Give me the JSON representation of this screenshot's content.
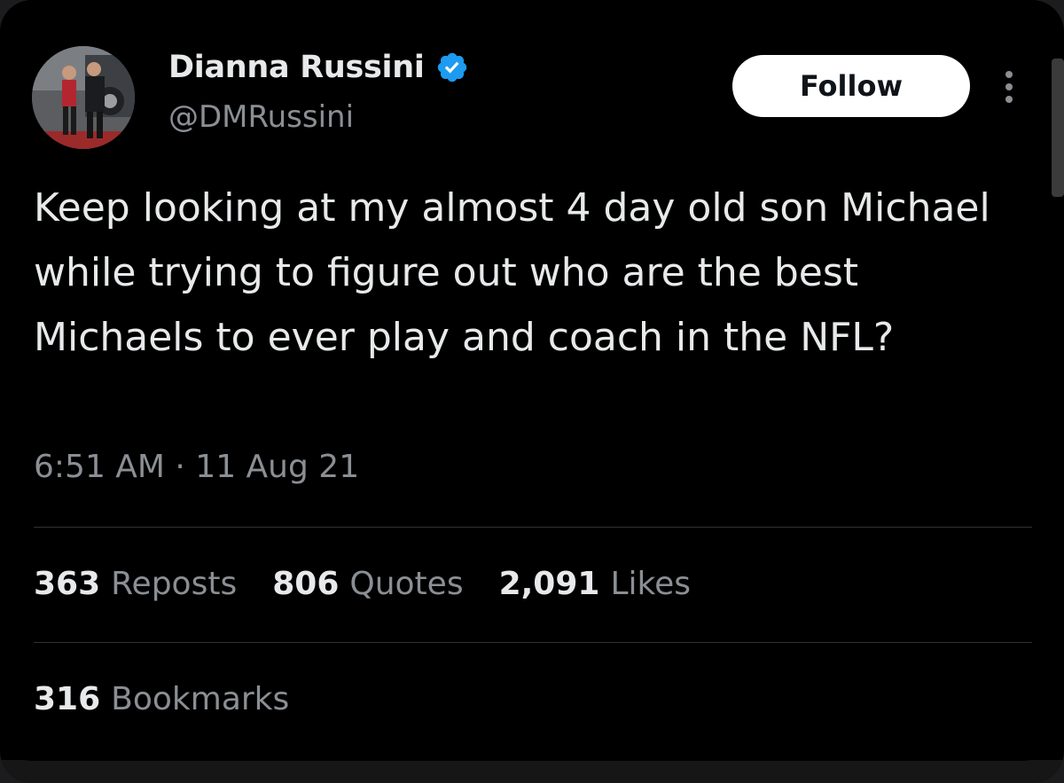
{
  "author": {
    "display_name": "Dianna Russini",
    "handle": "@DMRussini",
    "verified": true,
    "avatar_alt": "avatar"
  },
  "actions": {
    "follow_label": "Follow",
    "more_icon": "more-vertical-icon"
  },
  "tweet": {
    "text": "Keep looking at my almost 4 day old son Michael while trying to figure out who are the best Michaels to ever play and coach in the NFL?",
    "timestamp": "6:51 AM · 11 Aug 21"
  },
  "stats": [
    {
      "count": "363",
      "label": "Reposts"
    },
    {
      "count": "806",
      "label": "Quotes"
    },
    {
      "count": "2,091",
      "label": "Likes"
    }
  ],
  "bookmarks": {
    "count": "316",
    "label": "Bookmarks"
  },
  "colors": {
    "background": "#000000",
    "text_primary": "#e7e9ea",
    "text_secondary": "#8b8f94",
    "verified_blue": "#1d9bf0",
    "divider": "#2f3336"
  }
}
